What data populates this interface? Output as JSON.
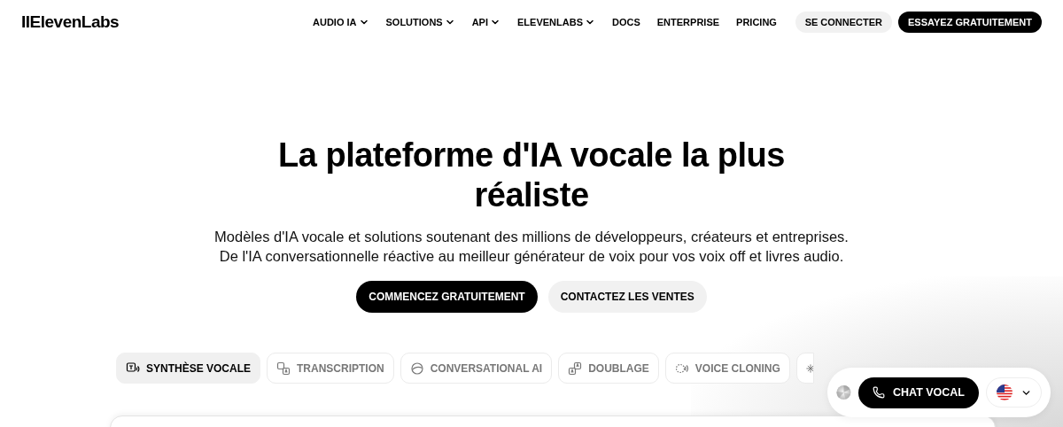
{
  "header": {
    "logo": "IIElevenLabs",
    "nav": [
      {
        "label": "AUDIO IA",
        "dropdown": true
      },
      {
        "label": "SOLUTIONS",
        "dropdown": true
      },
      {
        "label": "API",
        "dropdown": true
      },
      {
        "label": "ELEVENLABS",
        "dropdown": true
      },
      {
        "label": "DOCS",
        "dropdown": false
      },
      {
        "label": "ENTERPRISE",
        "dropdown": false
      },
      {
        "label": "PRICING",
        "dropdown": false
      }
    ],
    "login": "SE CONNECTER",
    "cta": "ESSAYEZ GRATUITEMENT"
  },
  "hero": {
    "title": "La plateforme d'IA vocale la plus réaliste",
    "subtitle": [
      "Modèles d'IA vocale et solutions soutenant des millions de développeurs, créateurs et entreprises.",
      "De l'IA conversationnelle réactive au meilleur générateur de voix pour vos voix off et livres audio."
    ],
    "primary": "COMMENCEZ GRATUITEMENT",
    "secondary": "CONTACTEZ LES VENTES"
  },
  "tabs": [
    {
      "kind": "tts",
      "label": "SYNTHÈSE VOCALE",
      "selected": true
    },
    {
      "kind": "transcription",
      "label": "TRANSCRIPTION",
      "selected": false
    },
    {
      "kind": "conversational",
      "label": "CONVERSATIONAL AI",
      "selected": false
    },
    {
      "kind": "dubbing",
      "label": "DOUBLAGE",
      "selected": false
    },
    {
      "kind": "cloning",
      "label": "VOICE CLONING",
      "selected": false
    },
    {
      "kind": "sparkle",
      "selected": false
    }
  ],
  "widget": {
    "call": "CHAT VOCAL"
  }
}
